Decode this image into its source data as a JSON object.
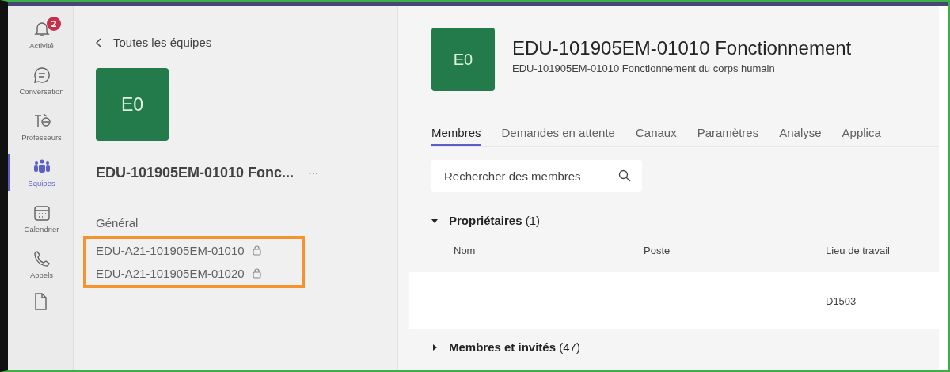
{
  "rail": [
    {
      "label": "Activité",
      "kind": "bell",
      "badge": "2",
      "selected": false
    },
    {
      "label": "Conversation",
      "kind": "chat",
      "selected": false
    },
    {
      "label": "Professeurs",
      "kind": "teacher",
      "selected": false
    },
    {
      "label": "Équipes",
      "kind": "teams",
      "selected": true
    },
    {
      "label": "Calendrier",
      "kind": "calendar",
      "selected": false
    },
    {
      "label": "Appels",
      "kind": "phone",
      "selected": false
    }
  ],
  "team_panel": {
    "back": "Toutes les équipes",
    "tile": "E0",
    "name": "EDU-101905EM-01010 Fonc...",
    "more": "···",
    "section": "Général",
    "channels": [
      {
        "name": "EDU-A21-101905EM-01010",
        "private": true
      },
      {
        "name": "EDU-A21-101905EM-01020",
        "private": true
      }
    ]
  },
  "header": {
    "tile": "E0",
    "title": "EDU-101905EM-01010 Fonctionnement",
    "subtitle": "EDU-101905EM-01010 Fonctionnement du corps humain"
  },
  "tabs": [
    {
      "label": "Membres",
      "selected": true
    },
    {
      "label": "Demandes en attente",
      "selected": false
    },
    {
      "label": "Canaux",
      "selected": false
    },
    {
      "label": "Paramètres",
      "selected": false
    },
    {
      "label": "Analyse",
      "selected": false
    },
    {
      "label": "Applica",
      "selected": false
    }
  ],
  "search": {
    "placeholder": "Rechercher des membres"
  },
  "sections": [
    {
      "heading": "**Propriétaires** (1)",
      "expanded": true,
      "columns": [
        "Nom",
        "Poste",
        "Lieu de travail"
      ],
      "rows": [
        {
          "workplace": "D1503"
        }
      ]
    },
    {
      "heading": "**Membres et invités** (47)",
      "expanded": false
    }
  ]
}
